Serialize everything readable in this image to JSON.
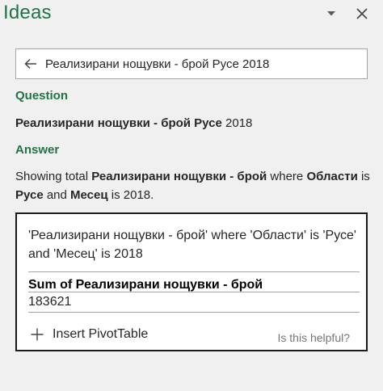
{
  "pane": {
    "title": "Ideas",
    "menu_icon": "chevron-down-icon",
    "close_icon": "close-icon"
  },
  "search": {
    "back_icon": "arrow-left-icon",
    "query": "Реализирани нощувки - брой Русе 2018"
  },
  "question": {
    "label": "Question",
    "bold": "Реализирани нощувки - брой Русе",
    "rest": " 2018"
  },
  "answer": {
    "label": "Answer",
    "parts": {
      "p1": "Showing total ",
      "b1": "Реализирани нощувки - брой",
      "p2": " where ",
      "b2": "Области",
      "p3": " is ",
      "b3": "Русе",
      "p4": " and ",
      "b4": "Месец",
      "p5": " is 2018."
    }
  },
  "card": {
    "description": "'Реализирани нощувки - брой' where 'Области' is 'Русе' and 'Месец' is 2018",
    "heading": "Sum of Реализирани нощувки - брой",
    "value": "183621",
    "insert_label": "Insert PivotTable",
    "insert_icon": "plus-icon",
    "helpful_label": "Is this helpful?"
  },
  "colors": {
    "accent": "#217346",
    "background": "#f0f0f0",
    "muted": "#767676"
  }
}
